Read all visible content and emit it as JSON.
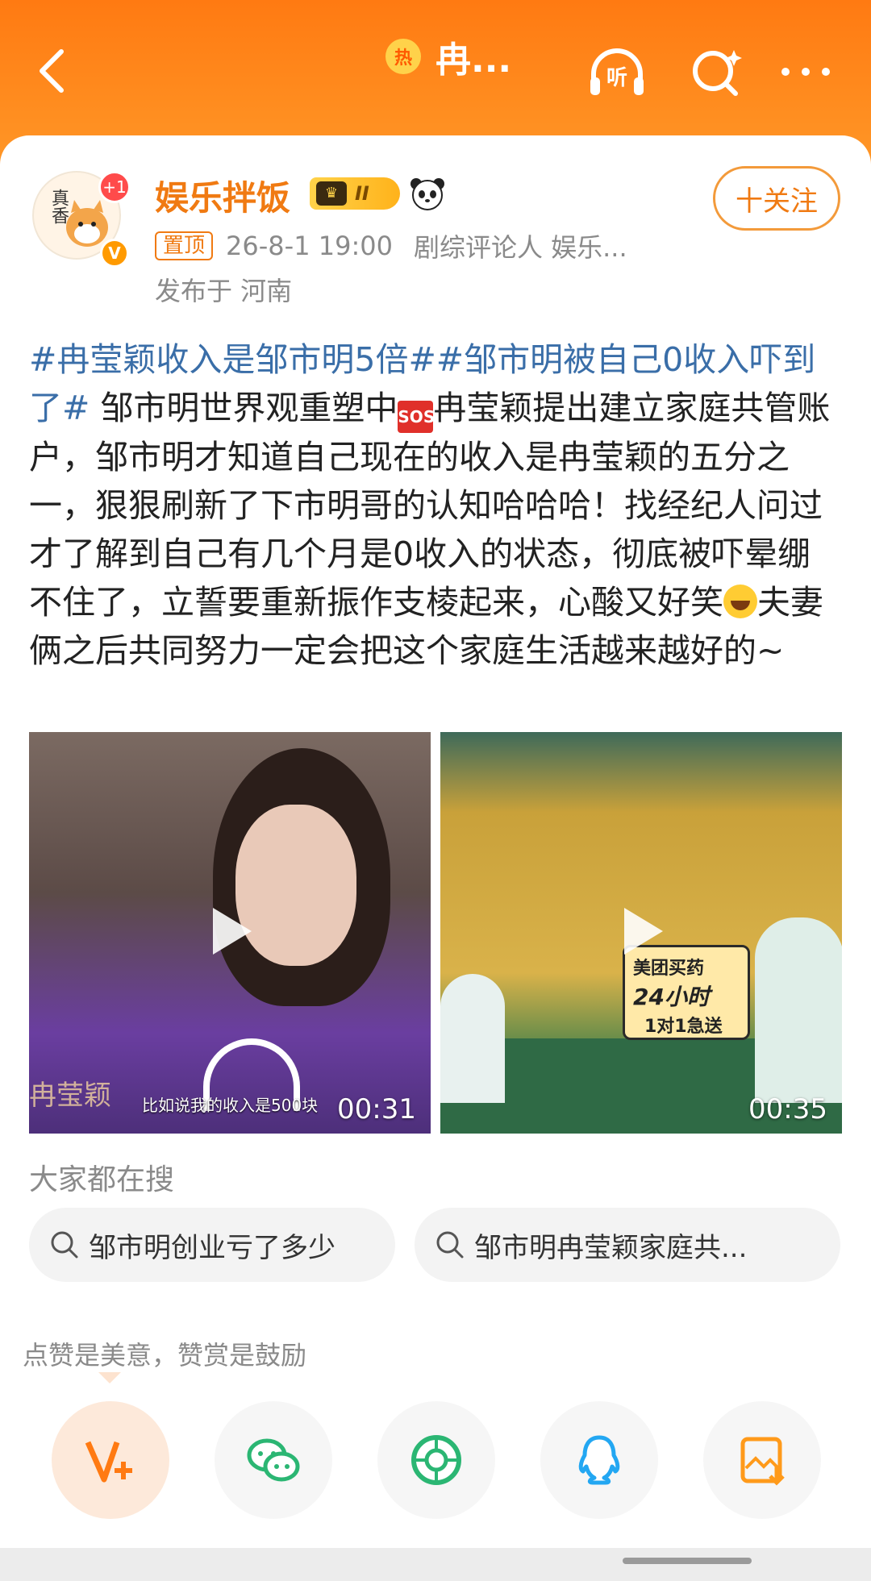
{
  "header": {
    "hot_icon_text": "热",
    "title": "冉...",
    "listen_label": "听",
    "back_icon": "back-arrow-icon",
    "search_icon": "search-icon",
    "more_icon": "more-dots-icon",
    "bg_color": "#ff8a1f"
  },
  "author": {
    "avatar_text": "真香",
    "avatar_badge": "+1",
    "verified_badge": "V",
    "name": "娱乐拌饭",
    "rank_badge": "II",
    "follow_label": "十关注",
    "pinned_label": "置顶",
    "time": "26-8-1 19:00",
    "description": "剧综评论人 娱乐...",
    "location": "发布于 河南",
    "name_color": "#f07a12"
  },
  "post": {
    "tag1": "#冉莹颖收入是邹市明5倍#",
    "tag2": "#邹市明被自己0收入吓到了#",
    "text_a": " 邹市明世界观重塑中",
    "sos": "SOS",
    "text_b": "冉莹颖提出建立家庭共管账户，邹市明才知道自己现在的收入是冉莹颖的五分之一，狠狠刷新了下市明哥的认知哈哈哈！找经纪人问过才了解到自己有几个月是0收入的状态，彻底被吓晕绷不住了，立誓要重新振作支棱起来，心酸又好笑",
    "text_c": "夫妻俩之后共同努力一定会把这个家庭生活越来越好的~",
    "tag_color": "#3a6ea8"
  },
  "videos": [
    {
      "duration": "00:31",
      "subtitle": "比如说我的收入是500块",
      "name_overlay": "冉莹颖"
    },
    {
      "duration": "00:35",
      "ad_line1": "美团买药",
      "ad_line2": "24小时",
      "ad_line3": "1对1急送"
    }
  ],
  "search": {
    "title": "大家都在搜",
    "chips": [
      "邹市明创业亏了多少",
      "邹市明冉莹颖家庭共..."
    ]
  },
  "reward": {
    "text": "点赞是美意，赞赏是鼓励"
  },
  "share": {
    "items": [
      "v-plus-icon",
      "wechat-icon",
      "moments-icon",
      "qq-icon",
      "save-image-icon"
    ]
  }
}
